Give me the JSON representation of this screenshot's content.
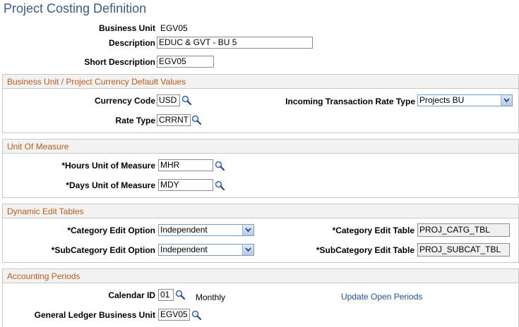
{
  "page": {
    "title": "Project Costing Definition"
  },
  "header": {
    "business_unit_label": "Business Unit",
    "business_unit_value": "EGV05",
    "description_label": "Description",
    "description_value": "EDUC & GVT - BU 5",
    "short_description_label": "Short Description",
    "short_description_value": "EGV05"
  },
  "currency_section": {
    "title": "Business Unit / Project Currency Default Values",
    "currency_code_label": "Currency Code",
    "currency_code_value": "USD",
    "incoming_rate_type_label": "Incoming Transaction Rate Type",
    "incoming_rate_type_value": "Projects BU",
    "rate_type_label": "Rate Type",
    "rate_type_value": "CRRNT"
  },
  "uom_section": {
    "title": "Unit Of Measure",
    "hours_label": "*Hours Unit of Measure",
    "hours_value": "MHR",
    "days_label": "*Days Unit of Measure",
    "days_value": "MDY"
  },
  "edit_tables_section": {
    "title": "Dynamic Edit Tables",
    "category_option_label": "*Category Edit Option",
    "category_option_value": "Independent",
    "category_table_label": "*Category Edit Table",
    "category_table_value": "PROJ_CATG_TBL",
    "subcategory_option_label": "*SubCategory Edit Option",
    "subcategory_option_value": "Independent",
    "subcategory_table_label": "*SubCategory Edit Table",
    "subcategory_table_value": "PROJ_SUBCAT_TBL"
  },
  "accounting_section": {
    "title": "Accounting Periods",
    "calendar_id_label": "Calendar ID",
    "calendar_id_value": "01",
    "calendar_desc": "Monthly",
    "update_link": "Update Open Periods",
    "gl_bu_label": "General Ledger Business Unit",
    "gl_bu_value": "EGV05"
  },
  "colors": {
    "title": "#3b5a8a",
    "section_header_text": "#c05a1a",
    "link": "#1c4f9c"
  }
}
